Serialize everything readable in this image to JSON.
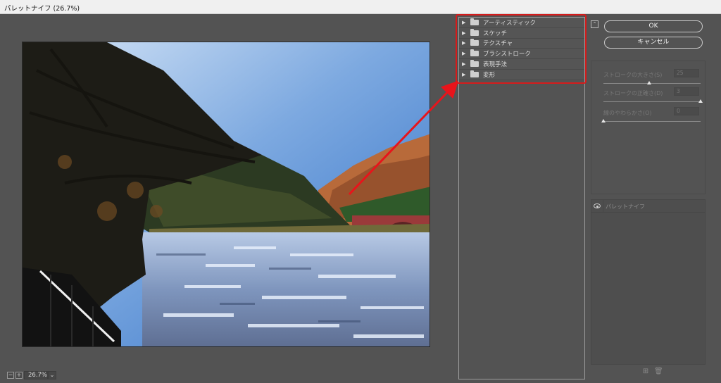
{
  "window": {
    "title": "パレットナイフ (26.7%)"
  },
  "zoom": {
    "value": "26.7%",
    "minus_label": "−",
    "plus_label": "+"
  },
  "filter_gallery": {
    "categories": [
      {
        "label": "アーティスティック"
      },
      {
        "label": "スケッチ"
      },
      {
        "label": "テクスチャ"
      },
      {
        "label": "ブラシストローク"
      },
      {
        "label": "表現手法"
      },
      {
        "label": "変形"
      }
    ]
  },
  "buttons": {
    "ok": "OK",
    "cancel": "キャンセル"
  },
  "settings": {
    "params": [
      {
        "label": "ストロークの大きさ(S)",
        "value": "25",
        "fraction": 0.47
      },
      {
        "label": "ストロークの正確さ(D)",
        "value": "3",
        "fraction": 1.0
      },
      {
        "label": "線のやわらかさ(O)",
        "value": "0",
        "fraction": 0.0
      }
    ]
  },
  "effect_layers": {
    "items": [
      {
        "name": "パレットナイフ"
      }
    ]
  },
  "colors": {
    "accent_red": "#d61b1b",
    "dialog_bg": "#535353"
  }
}
